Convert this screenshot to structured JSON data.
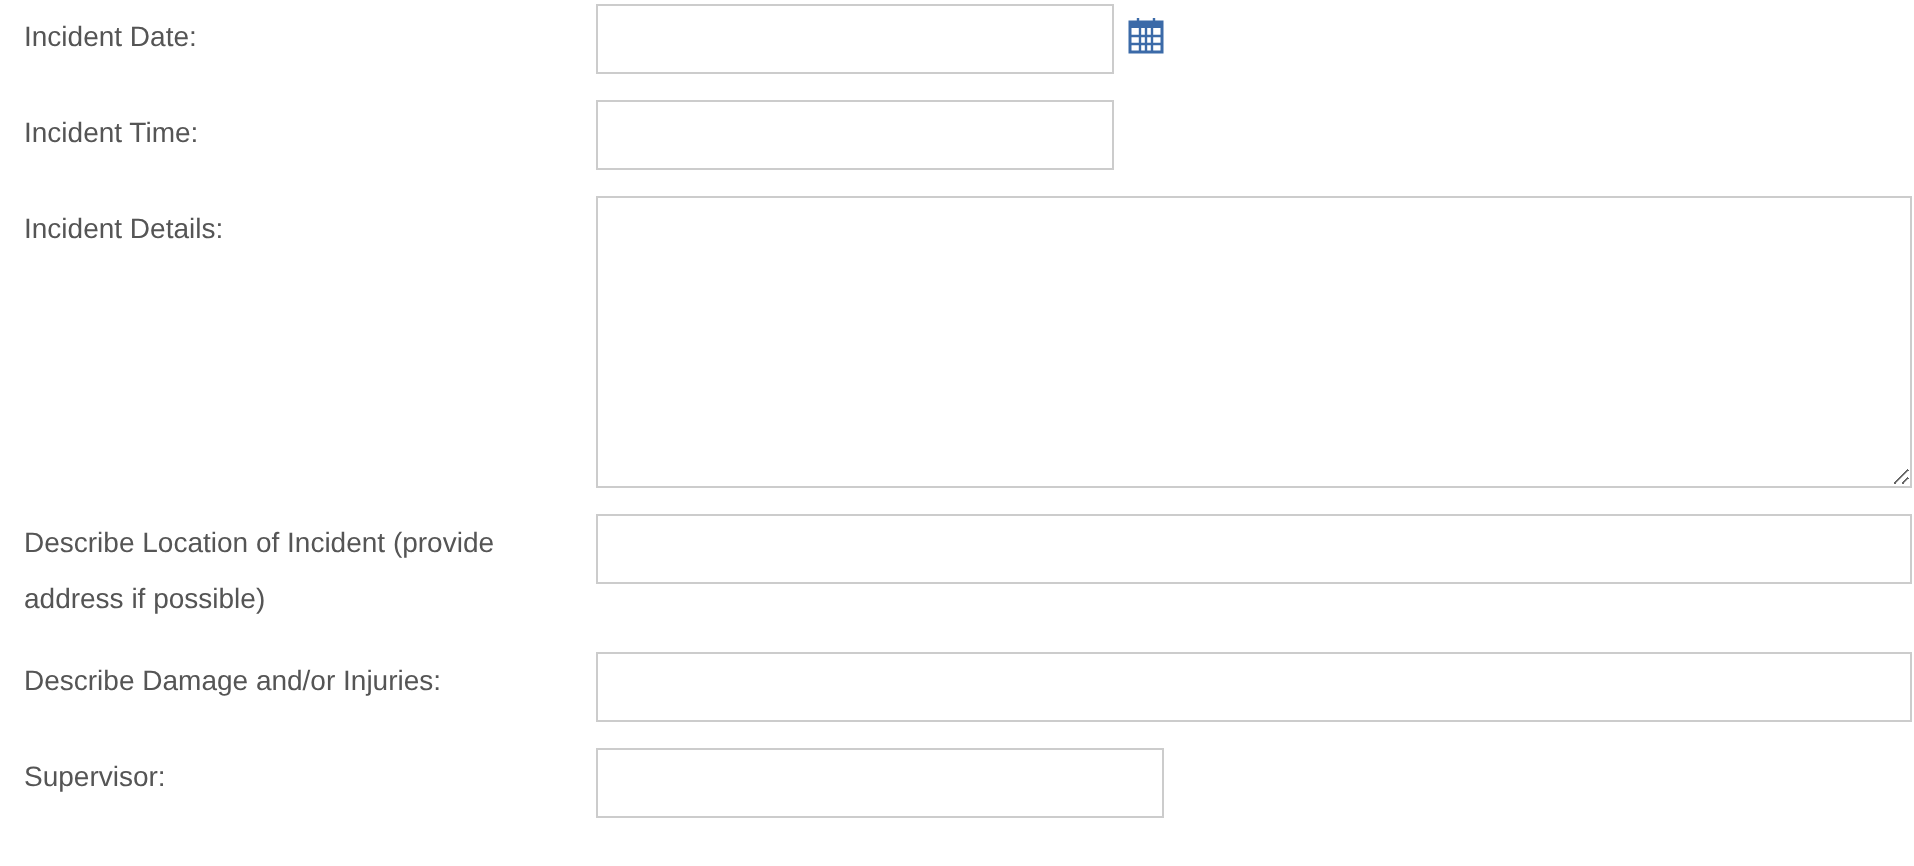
{
  "fields": [
    {
      "label": "Incident Date:",
      "kind": "date"
    },
    {
      "label": "Incident Time:",
      "kind": "short"
    },
    {
      "label": "Incident Details:",
      "kind": "multiline"
    },
    {
      "label": "Describe Location of Incident (provide address if possible)",
      "kind": "wide"
    },
    {
      "label": "Describe Damage and/or Injuries:",
      "kind": "wide"
    },
    {
      "label": "Supervisor:",
      "kind": "medium"
    }
  ]
}
